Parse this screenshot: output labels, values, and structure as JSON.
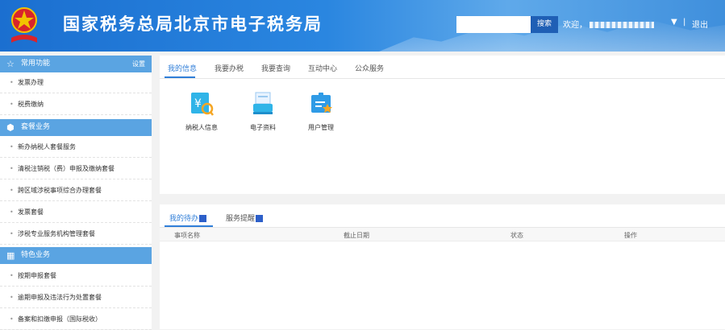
{
  "header": {
    "title": "国家税务总局北京市电子税务局",
    "search_placeholder": "",
    "search_button": "搜索",
    "welcome": "欢迎，",
    "user_caret": "▼",
    "separator": "|",
    "logout": "退出",
    "colors": {
      "banner": "#2a86e0",
      "search_button": "#1f5fb5"
    }
  },
  "sidebar": {
    "sections": [
      {
        "icon": "star-outline-icon",
        "label": "常用功能",
        "extra": "设置",
        "items": [
          "发票办理",
          "税费缴纳"
        ]
      },
      {
        "icon": "cube-icon",
        "label": "套餐业务",
        "items": [
          "新办纳税人套餐服务",
          "清税注销税（费）申报及缴纳套餐",
          "跨区域涉税事项综合办理套餐",
          "发票套餐",
          "涉税专业服务机构管理套餐"
        ]
      },
      {
        "icon": "grid-icon",
        "label": "特色业务",
        "items": [
          "按期申报套餐",
          "逾期申报及违法行为处置套餐",
          "备案和扣缴申报（国际税收）"
        ]
      }
    ],
    "colors": {
      "section_header": "#5aa4e2"
    }
  },
  "main": {
    "tabs": [
      "我的信息",
      "我要办税",
      "我要查询",
      "互动中心",
      "公众服务"
    ],
    "active_tab": 0,
    "apps": [
      {
        "icon": "taxpayer-info-icon",
        "label": "纳税人信息"
      },
      {
        "icon": "electronic-docs-icon",
        "label": "电子资料"
      },
      {
        "icon": "user-management-icon",
        "label": "用户管理"
      }
    ],
    "accent": "#2f7ed8"
  },
  "todo": {
    "tabs": [
      {
        "label": "我的待办",
        "badge": ""
      },
      {
        "label": "服务提醒",
        "badge": ""
      }
    ],
    "active_tab": 0,
    "columns": [
      "事项名称",
      "截止日期",
      "状态",
      "操作"
    ],
    "badge_color": "#2d5fc9"
  }
}
